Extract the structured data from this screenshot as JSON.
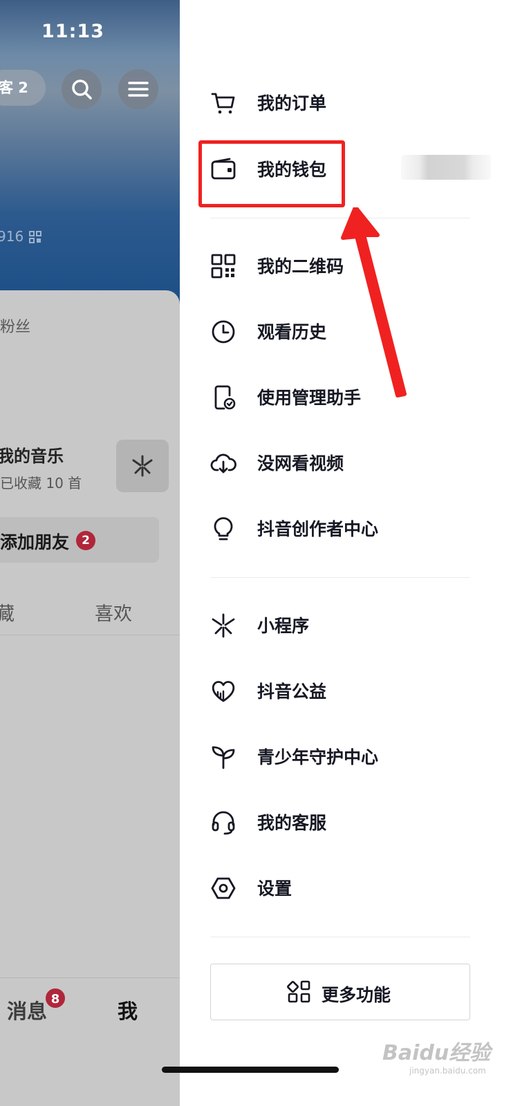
{
  "status_bar": {
    "time": "11:13"
  },
  "profile": {
    "visitor_label": "客 2",
    "id_fragment": "916",
    "fans_label": "粉丝",
    "music_title": "我的音乐",
    "music_subtitle": "已收藏 10 首",
    "add_friend_label": "添加朋友",
    "add_friend_badge": "2",
    "tabs": [
      "藏",
      "喜欢"
    ]
  },
  "bottom_nav": {
    "messages_label": "消息",
    "messages_badge": "8",
    "me_label": "我"
  },
  "drawer": {
    "items": [
      {
        "label": "我的订单",
        "icon": "cart-icon"
      },
      {
        "label": "我的钱包",
        "icon": "wallet-icon"
      },
      {
        "label": "我的二维码",
        "icon": "qr-code-icon"
      },
      {
        "label": "观看历史",
        "icon": "clock-icon"
      },
      {
        "label": "使用管理助手",
        "icon": "phone-check-icon"
      },
      {
        "label": "没网看视频",
        "icon": "cloud-download-icon"
      },
      {
        "label": "抖音创作者中心",
        "icon": "lightbulb-icon"
      },
      {
        "label": "小程序",
        "icon": "mini-program-icon"
      },
      {
        "label": "抖音公益",
        "icon": "heart-icon"
      },
      {
        "label": "青少年守护中心",
        "icon": "sprout-icon"
      },
      {
        "label": "我的客服",
        "icon": "headset-icon"
      },
      {
        "label": "设置",
        "icon": "hexagon-settings-icon"
      }
    ],
    "more_button": {
      "label": "更多功能",
      "icon": "grid-icon"
    }
  },
  "annotation": {
    "highlight_color": "#f02121"
  },
  "watermark": {
    "text": "Baidu经验",
    "sub": "jingyan.baidu.com"
  }
}
